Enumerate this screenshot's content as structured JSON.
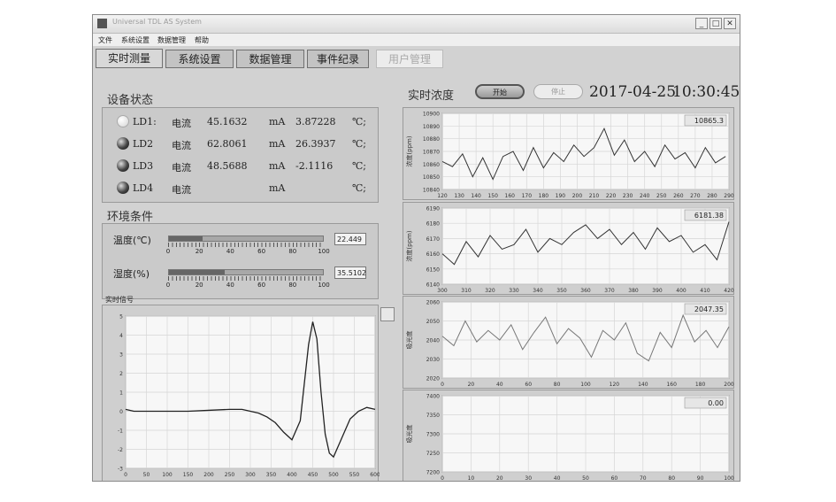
{
  "window": {
    "title": "Universal TDL AS System"
  },
  "menu": [
    "文件",
    "系统设置",
    "数据管理",
    "帮助"
  ],
  "tabs": [
    {
      "label": "实时测量",
      "state": "active"
    },
    {
      "label": "系统设置",
      "state": "normal"
    },
    {
      "label": "数据管理",
      "state": "normal"
    },
    {
      "label": "事件纪录",
      "state": "normal"
    },
    {
      "label": "用户管理",
      "state": "disabled"
    }
  ],
  "device_status": {
    "title": "设备状态",
    "rows": [
      {
        "name": "LD1:",
        "led": "off",
        "label": "电流",
        "current": "45.1632",
        "unit": "mA",
        "temp": "3.87228",
        "temp_unit": "℃;"
      },
      {
        "name": "LD2",
        "led": "on",
        "label": "电流",
        "current": "62.8061",
        "unit": "mA",
        "temp": "26.3937",
        "temp_unit": "℃;"
      },
      {
        "name": "LD3",
        "led": "on",
        "label": "电流",
        "current": "48.5688",
        "unit": "mA",
        "temp": "-2.1116",
        "temp_unit": "℃;"
      },
      {
        "name": "LD4",
        "led": "on",
        "label": "电流",
        "current": "",
        "unit": "mA",
        "temp": "",
        "temp_unit": "℃;"
      }
    ]
  },
  "environment": {
    "title": "环境条件",
    "temperature": {
      "label": "温度(℃)",
      "value": "22.449",
      "level": 0.22
    },
    "humidity": {
      "label": "湿度(%)",
      "value": "35.5102",
      "level": 0.36
    },
    "scale": [
      "0",
      "20",
      "40",
      "60",
      "80",
      "100"
    ]
  },
  "realtime_signal": {
    "title": "实时信号"
  },
  "concentration": {
    "title": "实时浓度",
    "start_label": "开始",
    "stop_label": "停止",
    "date": "2017-04-25",
    "time": "10:30:45"
  },
  "colors": {
    "window_bg": "#d2d2d2",
    "plot_bg": "#f7f7f7",
    "grid": "#d6d6d6",
    "trace": "#333333"
  },
  "chart_data": [
    {
      "type": "line",
      "title": "实时信号",
      "xlim": [
        0,
        600
      ],
      "ylim": [
        -3,
        5
      ],
      "xticks": [
        "0",
        "50",
        "100",
        "150",
        "200",
        "250",
        "300",
        "350",
        "400",
        "450",
        "500",
        "550",
        "600"
      ],
      "yticks": [
        "5",
        "4",
        "3",
        "2",
        "1",
        "0",
        "-1",
        "-2",
        "-3"
      ],
      "x": [
        0,
        20,
        50,
        100,
        150,
        200,
        250,
        280,
        300,
        320,
        340,
        360,
        380,
        400,
        420,
        440,
        450,
        460,
        470,
        480,
        490,
        500,
        520,
        540,
        560,
        580,
        600
      ],
      "y": [
        0.1,
        0.0,
        0.0,
        0.0,
        0.0,
        0.05,
        0.1,
        0.1,
        0.0,
        -0.1,
        -0.3,
        -0.6,
        -1.1,
        -1.5,
        -0.5,
        3.5,
        4.7,
        3.8,
        1.0,
        -1.2,
        -2.2,
        -2.4,
        -1.4,
        -0.4,
        0.0,
        0.2,
        0.1
      ]
    },
    {
      "type": "line",
      "ylabel": "浓度(ppm)",
      "readout": "10865.3",
      "xlim": [
        120,
        290
      ],
      "ylim": [
        10840,
        10900
      ],
      "xticks": [
        "120",
        "130",
        "140",
        "150",
        "160",
        "170",
        "180",
        "190",
        "200",
        "210",
        "220",
        "230",
        "240",
        "250",
        "260",
        "270",
        "280",
        "290"
      ],
      "yticks": [
        "10900",
        "10890",
        "10880",
        "10870",
        "10860",
        "10850",
        "10840"
      ],
      "x": [
        120,
        126,
        132,
        138,
        144,
        150,
        156,
        162,
        168,
        174,
        180,
        186,
        192,
        198,
        204,
        210,
        216,
        222,
        228,
        234,
        240,
        246,
        252,
        258,
        264,
        270,
        276,
        282,
        288
      ],
      "y": [
        10862,
        10858,
        10868,
        10850,
        10865,
        10848,
        10866,
        10870,
        10855,
        10873,
        10857,
        10869,
        10862,
        10875,
        10866,
        10873,
        10888,
        10867,
        10879,
        10862,
        10870,
        10858,
        10875,
        10864,
        10869,
        10857,
        10873,
        10861,
        10866
      ]
    },
    {
      "type": "line",
      "ylabel": "浓度(ppm)",
      "readout": "6181.38",
      "xlim": [
        300,
        420
      ],
      "ylim": [
        6140,
        6190
      ],
      "xticks": [
        "300",
        "310",
        "320",
        "330",
        "340",
        "350",
        "360",
        "370",
        "380",
        "390",
        "400",
        "410",
        "420"
      ],
      "yticks": [
        "6190",
        "6180",
        "6170",
        "6160",
        "6150",
        "6140"
      ],
      "x": [
        300,
        305,
        310,
        315,
        320,
        325,
        330,
        335,
        340,
        345,
        350,
        355,
        360,
        365,
        370,
        375,
        380,
        385,
        390,
        395,
        400,
        405,
        410,
        415,
        420
      ],
      "y": [
        6160,
        6153,
        6168,
        6158,
        6172,
        6163,
        6166,
        6176,
        6161,
        6170,
        6166,
        6174,
        6179,
        6170,
        6176,
        6166,
        6174,
        6163,
        6177,
        6168,
        6172,
        6161,
        6166,
        6156,
        6181
      ]
    },
    {
      "type": "line",
      "ylabel": "吸光度",
      "readout": "2047.35",
      "xlim": [
        0,
        200
      ],
      "ylim": [
        2020,
        2060
      ],
      "xticks": [
        "0",
        "20",
        "40",
        "60",
        "80",
        "100",
        "120",
        "140",
        "160",
        "180",
        "200"
      ],
      "yticks": [
        "2060",
        "2050",
        "2040",
        "2030",
        "2020"
      ],
      "x": [
        0,
        8,
        16,
        24,
        32,
        40,
        48,
        56,
        64,
        72,
        80,
        88,
        96,
        104,
        112,
        120,
        128,
        136,
        144,
        152,
        160,
        168,
        176,
        184,
        192,
        200
      ],
      "y": [
        2042,
        2037,
        2050,
        2039,
        2045,
        2040,
        2048,
        2035,
        2044,
        2052,
        2038,
        2046,
        2041,
        2031,
        2045,
        2040,
        2049,
        2033,
        2029,
        2044,
        2036,
        2053,
        2039,
        2045,
        2036,
        2047
      ]
    },
    {
      "type": "line",
      "ylabel": "吸光度",
      "readout": "0.00",
      "xlim": [
        0,
        100
      ],
      "ylim": [
        7200,
        7400
      ],
      "xticks": [
        "0",
        "10",
        "20",
        "30",
        "40",
        "50",
        "60",
        "70",
        "80",
        "90",
        "100"
      ],
      "yticks": [
        "7400",
        "7350",
        "7300",
        "7250",
        "7200"
      ],
      "x": [],
      "y": []
    }
  ]
}
